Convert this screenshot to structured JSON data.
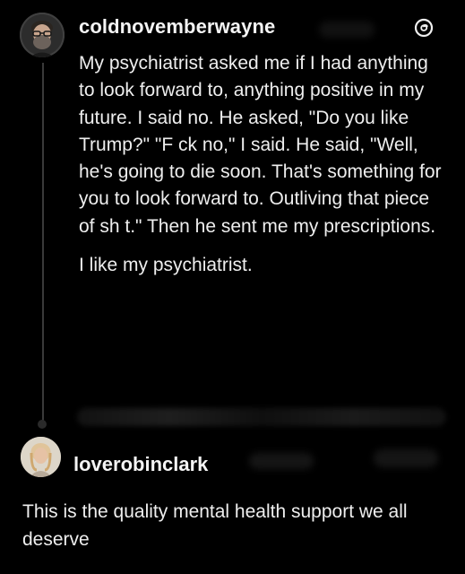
{
  "post": {
    "username": "coldnovemberwayne",
    "body": "My psychiatrist asked me if I had anything to look forward to, anything positive in my future. I said no. He asked, \"Do you like Trump?\" \"F ck no,\" I said. He said, \"Well, he's going to die soon. That's something for you to look forward to. Outliving that piece of sh t.\" Then he sent me my prescriptions.",
    "body_second": "I like my psychiatrist.",
    "platform_icon": "threads-icon"
  },
  "reply": {
    "username": "loverobinclark",
    "body": "This is the quality mental health support we all deserve"
  },
  "colors": {
    "background": "#000000",
    "text": "#eeeeee",
    "thread_line": "#3a3a3a"
  }
}
